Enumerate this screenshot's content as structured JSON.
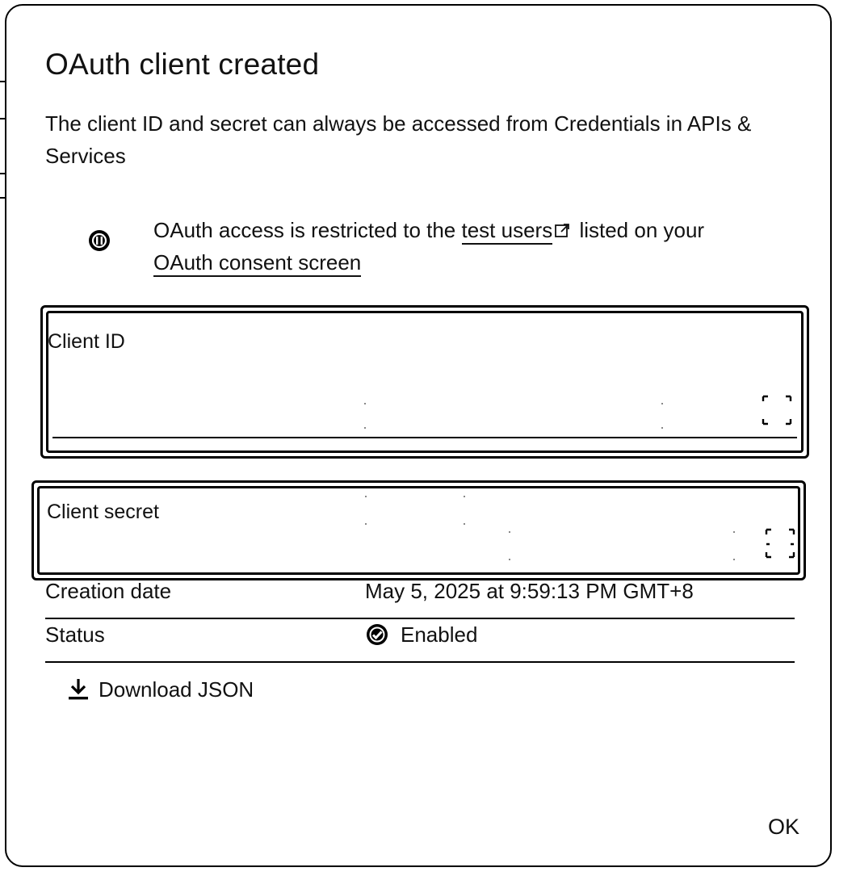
{
  "dialog": {
    "title": "OAuth client created",
    "subtitle": "The client ID and secret can always be accessed from Credentials in APIs & Services"
  },
  "notice": {
    "text_before": "OAuth access is restricted to the ",
    "link_test_users": "test users",
    "text_middle": " listed on your ",
    "link_consent_screen": "OAuth consent screen",
    "icon": "info-icon"
  },
  "fields": {
    "client_id": {
      "label": "Client ID",
      "value": "",
      "copy_icon": "copy-icon"
    },
    "client_secret": {
      "label": "Client secret",
      "value": "",
      "copy_icon": "copy-icon"
    }
  },
  "details": {
    "creation_date_label": "Creation date",
    "creation_date_value": "May 5, 2025 at 9:59:13 PM GMT+8",
    "status_label": "Status",
    "status_value": "Enabled",
    "status_icon": "check-circle-icon"
  },
  "actions": {
    "download_label": "Download JSON",
    "download_icon": "download-icon",
    "ok_label": "OK"
  }
}
